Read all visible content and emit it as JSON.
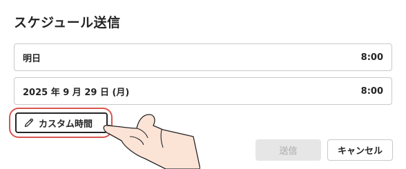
{
  "dialog": {
    "title": "スケジュール送信"
  },
  "options": [
    {
      "label": "明日",
      "time": "8:00"
    },
    {
      "label": "2025 年 9 月 29 日 (月)",
      "time": "8:00"
    }
  ],
  "custom": {
    "label": "カスタム時間",
    "icon": "pencil-icon"
  },
  "actions": {
    "send_label": "送信",
    "cancel_label": "キャンセル"
  },
  "annotation": {
    "highlight_color": "#d9534f",
    "pointer": "hand-pointer"
  }
}
